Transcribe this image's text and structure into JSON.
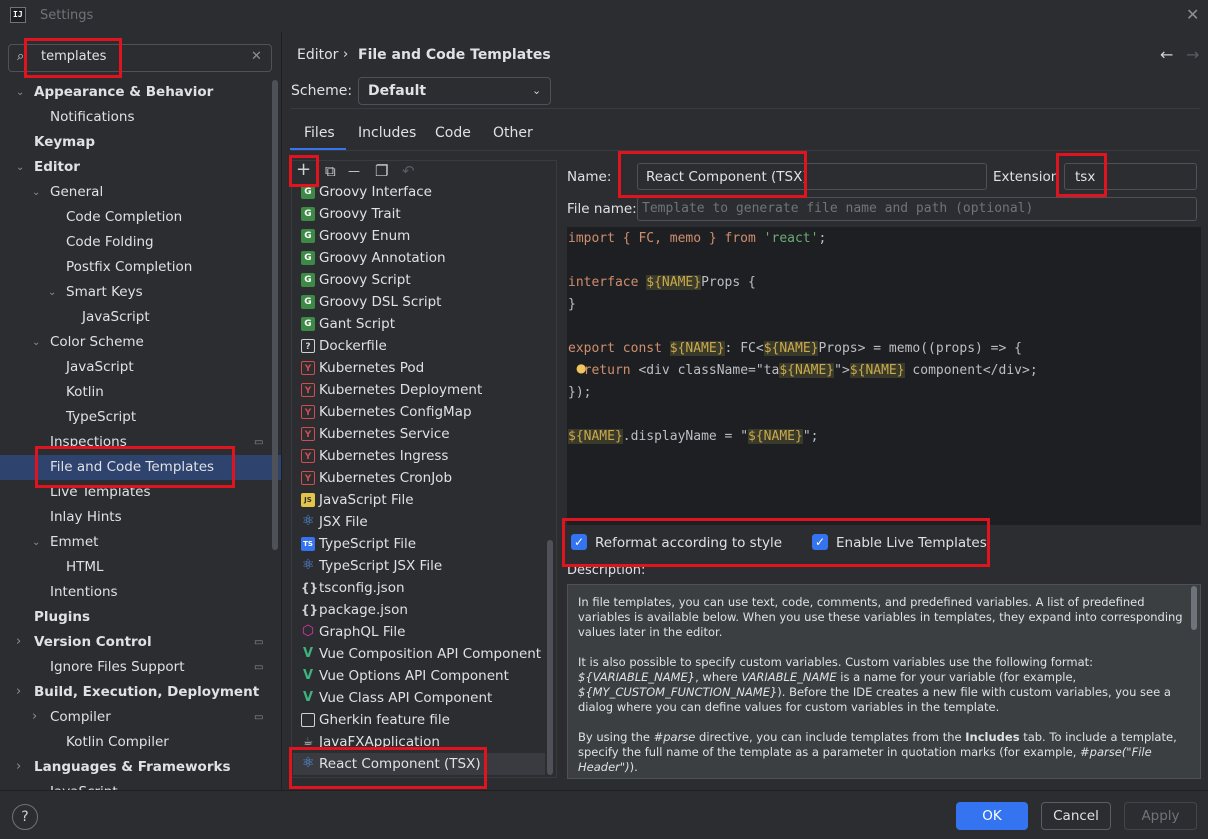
{
  "window": {
    "title": "Settings",
    "app_icon": "intellij-icon"
  },
  "search": {
    "value": "templates"
  },
  "sidebar": {
    "items": [
      {
        "label": "Appearance & Behavior",
        "bold": true
      },
      {
        "label": "Notifications"
      },
      {
        "label": "Keymap",
        "bold": true
      },
      {
        "label": "Editor",
        "bold": true
      },
      {
        "label": "General"
      },
      {
        "label": "Code Completion"
      },
      {
        "label": "Code Folding"
      },
      {
        "label": "Postfix Completion"
      },
      {
        "label": "Smart Keys"
      },
      {
        "label": "JavaScript"
      },
      {
        "label": "Color Scheme"
      },
      {
        "label": "JavaScript"
      },
      {
        "label": "Kotlin"
      },
      {
        "label": "TypeScript"
      },
      {
        "label": "Inspections"
      },
      {
        "label": "File and Code Templates",
        "selected": true
      },
      {
        "label": "Live Templates"
      },
      {
        "label": "Inlay Hints"
      },
      {
        "label": "Emmet"
      },
      {
        "label": "HTML"
      },
      {
        "label": "Intentions"
      },
      {
        "label": "Plugins",
        "bold": true
      },
      {
        "label": "Version Control",
        "bold": true
      },
      {
        "label": "Ignore Files Support"
      },
      {
        "label": "Build, Execution, Deployment",
        "bold": true
      },
      {
        "label": "Compiler"
      },
      {
        "label": "Kotlin Compiler"
      },
      {
        "label": "Languages & Frameworks",
        "bold": true
      },
      {
        "label": "JavaScript"
      }
    ]
  },
  "breadcrumb": {
    "parent": "Editor",
    "separator": "›",
    "current": "File and Code Templates"
  },
  "scheme": {
    "label": "Scheme:",
    "value": "Default"
  },
  "tabs": [
    {
      "label": "Files",
      "active": true
    },
    {
      "label": "Includes"
    },
    {
      "label": "Code"
    },
    {
      "label": "Other"
    }
  ],
  "toolbar": {
    "add": "+",
    "copy": "⧉",
    "remove": "—",
    "duplicate": "❐",
    "reset": "↶"
  },
  "templates": [
    {
      "label": "Groovy Interface",
      "icon": "G",
      "kind": "g"
    },
    {
      "label": "Groovy Trait",
      "icon": "G",
      "kind": "g"
    },
    {
      "label": "Groovy Enum",
      "icon": "G",
      "kind": "g"
    },
    {
      "label": "Groovy Annotation",
      "icon": "G",
      "kind": "g"
    },
    {
      "label": "Groovy Script",
      "icon": "G",
      "kind": "g"
    },
    {
      "label": "Groovy DSL Script",
      "icon": "G",
      "kind": "g"
    },
    {
      "label": "Gant Script",
      "icon": "G",
      "kind": "g"
    },
    {
      "label": "Dockerfile",
      "icon": "?",
      "kind": "q"
    },
    {
      "label": "Kubernetes Pod",
      "icon": "Y",
      "kind": "y"
    },
    {
      "label": "Kubernetes Deployment",
      "icon": "Y",
      "kind": "y"
    },
    {
      "label": "Kubernetes ConfigMap",
      "icon": "Y",
      "kind": "y"
    },
    {
      "label": "Kubernetes Service",
      "icon": "Y",
      "kind": "y"
    },
    {
      "label": "Kubernetes Ingress",
      "icon": "Y",
      "kind": "y"
    },
    {
      "label": "Kubernetes CronJob",
      "icon": "Y",
      "kind": "y"
    },
    {
      "label": "JavaScript File",
      "icon": "JS",
      "kind": "js"
    },
    {
      "label": "JSX File",
      "icon": "⚛",
      "kind": "react"
    },
    {
      "label": "TypeScript File",
      "icon": "TS",
      "kind": "ts"
    },
    {
      "label": "TypeScript JSX File",
      "icon": "⚛",
      "kind": "react"
    },
    {
      "label": "tsconfig.json",
      "icon": "{}",
      "kind": "brace"
    },
    {
      "label": "package.json",
      "icon": "{}",
      "kind": "brace"
    },
    {
      "label": "GraphQL File",
      "icon": "⬡",
      "kind": "gql"
    },
    {
      "label": "Vue Composition API Component",
      "icon": "V",
      "kind": "vue"
    },
    {
      "label": "Vue Options API Component",
      "icon": "V",
      "kind": "vue"
    },
    {
      "label": "Vue Class API Component",
      "icon": "V",
      "kind": "vue"
    },
    {
      "label": "Gherkin feature file",
      "icon": "",
      "kind": "gherkin"
    },
    {
      "label": "JavaFXApplication",
      "icon": "☕",
      "kind": "java"
    },
    {
      "label": "React Component (TSX)",
      "icon": "⚛",
      "kind": "react",
      "selected": true
    }
  ],
  "form": {
    "name_label": "Name:",
    "name_value": "React Component (TSX)",
    "extension_label": "Extension",
    "extension_value": "tsx",
    "file_name_label": "File name:",
    "file_name_placeholder": "Template to generate file name and path (optional)"
  },
  "code": {
    "l1a": "import { FC, memo } from ",
    "l1b": "'react'",
    "l1c": ";",
    "l2a": "interface ",
    "l2b": "${NAME}",
    "l2c": "Props {",
    "l3": "}",
    "l4a": "export const ",
    "l4b": "${NAME}",
    "l4c": ": FC<",
    "l4d": "${NAME}",
    "l4e": "Props> = memo((props) => {",
    "l5a": "  return ",
    "l5b": "<div className=\"ta",
    "l5c": "${NAME}",
    "l5d": "\">",
    "l5e": "${NAME}",
    "l5f": " component</div>;",
    "l6": "});",
    "l7a": "${NAME}",
    "l7b": ".displayName = \"",
    "l7c": "${NAME}",
    "l7d": "\";"
  },
  "options": {
    "reformat_label": "Reformat according to style",
    "reformat_checked": true,
    "live_templates_label": "Enable Live Templates",
    "live_templates_checked": true
  },
  "description": {
    "label": "Description:",
    "p1": "In file templates, you can use text, code, comments, and predefined variables. A list of predefined variables is available below. When you use these variables in templates, they expand into corresponding values later in the editor.",
    "p2a": "It is also possible to specify custom variables. Custom variables use the following format: ",
    "p2b": "${VARIABLE_NAME}",
    "p2c": ", where ",
    "p2d": "VARIABLE_NAME",
    "p2e": " is a name for your variable (for example, ",
    "p2f": "${MY_CUSTOM_FUNCTION_NAME}",
    "p2g": "). Before the IDE creates a new file with custom variables, you see a dialog where you can define values for custom variables in the template.",
    "p3a": "By using the ",
    "p3b": "#parse",
    "p3c": " directive, you can include templates from the ",
    "p3d": "Includes",
    "p3e": " tab. To include a template, specify the full name of the template as a parameter in quotation marks (for example, ",
    "p3f": "#parse(\"File Header\")",
    "p3g": ")."
  },
  "footer": {
    "help": "?",
    "ok": "OK",
    "cancel": "Cancel",
    "apply": "Apply"
  },
  "colors": {
    "accent": "#3574f0",
    "highlight": "#e0141e",
    "background": "#2b2d30",
    "editor_bg": "#1e1f22"
  }
}
